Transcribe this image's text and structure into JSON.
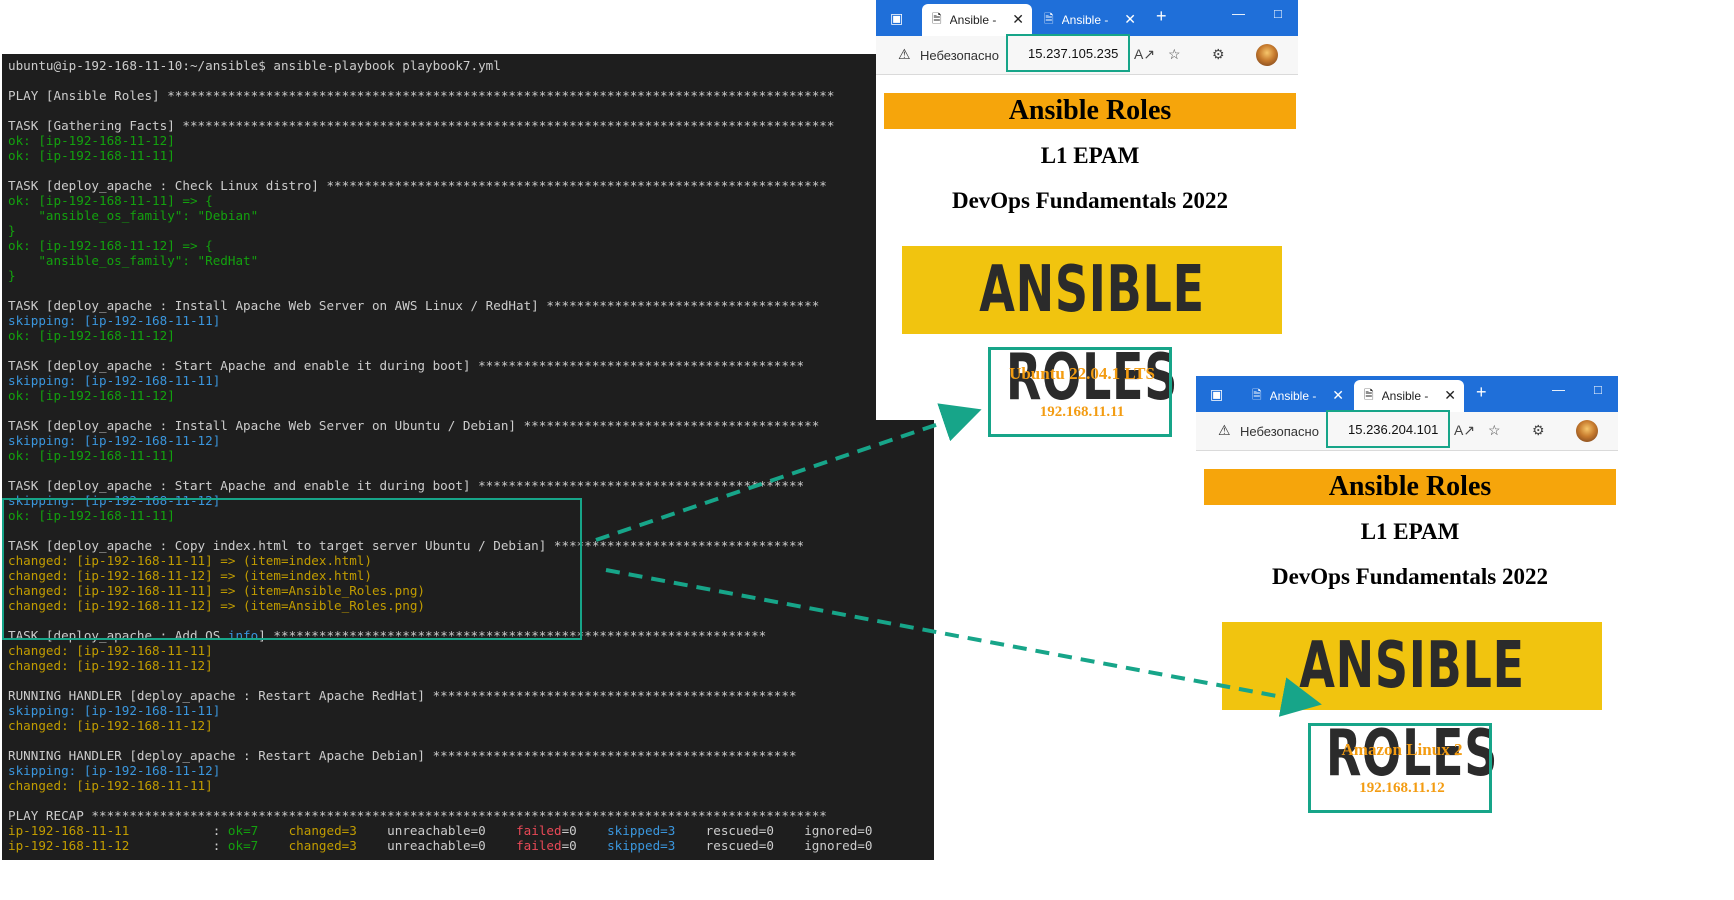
{
  "terminal": {
    "lines": [
      [
        {
          "t": "ubuntu@ip-192-168-11-10:~/ansible$ ansible-playbook playbook7.yml",
          "c": "w"
        }
      ],
      [
        {
          "t": "",
          "c": "w"
        }
      ],
      [
        {
          "t": "PLAY [Ansible Roles] ****************************************************************************************",
          "c": "w"
        }
      ],
      [
        {
          "t": "",
          "c": "w"
        }
      ],
      [
        {
          "t": "TASK [Gathering Facts] **************************************************************************************",
          "c": "w"
        }
      ],
      [
        {
          "t": "ok: [ip-192-168-11-12]",
          "c": "ok"
        }
      ],
      [
        {
          "t": "ok: [ip-192-168-11-11]",
          "c": "ok"
        }
      ],
      [
        {
          "t": "",
          "c": "w"
        }
      ],
      [
        {
          "t": "TASK [deploy_apache : Check Linux distro] ******************************************************************",
          "c": "w"
        }
      ],
      [
        {
          "t": "ok: [ip-192-168-11-11] => {",
          "c": "ok"
        }
      ],
      [
        {
          "t": "    \"ansible_os_family\": \"Debian\"",
          "c": "ok"
        }
      ],
      [
        {
          "t": "}",
          "c": "ok"
        }
      ],
      [
        {
          "t": "ok: [ip-192-168-11-12] => {",
          "c": "ok"
        }
      ],
      [
        {
          "t": "    \"ansible_os_family\": \"RedHat\"",
          "c": "ok"
        }
      ],
      [
        {
          "t": "}",
          "c": "ok"
        }
      ],
      [
        {
          "t": "",
          "c": "w"
        }
      ],
      [
        {
          "t": "TASK [deploy_apache : Install Apache Web Server on AWS Linux / RedHat] ************************************",
          "c": "w"
        }
      ],
      [
        {
          "t": "skipping: [ip-192-168-11-11]",
          "c": "c"
        }
      ],
      [
        {
          "t": "ok: [ip-192-168-11-12]",
          "c": "ok"
        }
      ],
      [
        {
          "t": "",
          "c": "w"
        }
      ],
      [
        {
          "t": "TASK [deploy_apache : Start Apache and enable it during boot] *******************************************",
          "c": "w"
        }
      ],
      [
        {
          "t": "skipping: [ip-192-168-11-11]",
          "c": "c"
        }
      ],
      [
        {
          "t": "ok: [ip-192-168-11-12]",
          "c": "ok"
        }
      ],
      [
        {
          "t": "",
          "c": "w"
        }
      ],
      [
        {
          "t": "TASK [deploy_apache : Install Apache Web Server on Ubuntu / Debian] ***************************************",
          "c": "w"
        }
      ],
      [
        {
          "t": "skipping: [ip-192-168-11-12]",
          "c": "c"
        }
      ],
      [
        {
          "t": "ok: [ip-192-168-11-11]",
          "c": "ok"
        }
      ],
      [
        {
          "t": "",
          "c": "w"
        }
      ],
      [
        {
          "t": "TASK [deploy_apache : Start Apache and enable it during boot] *******************************************",
          "c": "w"
        }
      ],
      [
        {
          "t": "skipping: [ip-192-168-11-12]",
          "c": "c"
        }
      ],
      [
        {
          "t": "ok: [ip-192-168-11-11]",
          "c": "ok"
        }
      ],
      [
        {
          "t": "",
          "c": "w"
        }
      ],
      [
        {
          "t": "TASK [deploy_apache : Copy index.html to target server Ubuntu / Debian] *********************************",
          "c": "w"
        }
      ],
      [
        {
          "t": "changed: [ip-192-168-11-11] => (item=index.html)",
          "c": "y"
        }
      ],
      [
        {
          "t": "changed: [ip-192-168-11-12] => (item=index.html)",
          "c": "y"
        }
      ],
      [
        {
          "t": "changed: [ip-192-168-11-11] => (item=Ansible_Roles.png)",
          "c": "y"
        }
      ],
      [
        {
          "t": "changed: [ip-192-168-11-12] => (item=Ansible_Roles.png)",
          "c": "y"
        }
      ],
      [
        {
          "t": "",
          "c": "w"
        }
      ],
      [
        {
          "t": "TASK [deploy_apache : Add OS ",
          "c": "w"
        },
        {
          "t": "info",
          "c": "c"
        },
        {
          "t": "] *****************************************************************",
          "c": "w"
        }
      ],
      [
        {
          "t": "changed: [ip-192-168-11-11]",
          "c": "y"
        }
      ],
      [
        {
          "t": "changed: [ip-192-168-11-12]",
          "c": "y"
        }
      ],
      [
        {
          "t": "",
          "c": "w"
        }
      ],
      [
        {
          "t": "RUNNING HANDLER [deploy_apache : Restart Apache RedHat] ************************************************",
          "c": "w"
        }
      ],
      [
        {
          "t": "skipping: [ip-192-168-11-11]",
          "c": "c"
        }
      ],
      [
        {
          "t": "changed: [ip-192-168-11-12]",
          "c": "y"
        }
      ],
      [
        {
          "t": "",
          "c": "w"
        }
      ],
      [
        {
          "t": "RUNNING HANDLER [deploy_apache : Restart Apache Debian] ************************************************",
          "c": "w"
        }
      ],
      [
        {
          "t": "skipping: [ip-192-168-11-12]",
          "c": "c"
        }
      ],
      [
        {
          "t": "changed: [ip-192-168-11-11]",
          "c": "y"
        }
      ],
      [
        {
          "t": "",
          "c": "w"
        }
      ],
      [
        {
          "t": "PLAY RECAP *************************************************************************************************",
          "c": "w"
        }
      ],
      [
        {
          "t": "ip-192-168-11-11",
          "c": "y"
        },
        {
          "t": "           : ",
          "c": "w"
        },
        {
          "t": "ok=7",
          "c": "ok"
        },
        {
          "t": "    ",
          "c": "w"
        },
        {
          "t": "changed=3",
          "c": "y"
        },
        {
          "t": "    unreachable=0    ",
          "c": "w"
        },
        {
          "t": "failed",
          "c": "r"
        },
        {
          "t": "=0    ",
          "c": "w"
        },
        {
          "t": "skipped=3",
          "c": "c"
        },
        {
          "t": "    rescued=0    ignored=0",
          "c": "w"
        }
      ],
      [
        {
          "t": "ip-192-168-11-12",
          "c": "y"
        },
        {
          "t": "           : ",
          "c": "w"
        },
        {
          "t": "ok=7",
          "c": "ok"
        },
        {
          "t": "    ",
          "c": "w"
        },
        {
          "t": "changed=3",
          "c": "y"
        },
        {
          "t": "    unreachable=0    ",
          "c": "w"
        },
        {
          "t": "failed",
          "c": "r"
        },
        {
          "t": "=0    ",
          "c": "w"
        },
        {
          "t": "skipped=3",
          "c": "c"
        },
        {
          "t": "    rescued=0    ignored=0",
          "c": "w"
        }
      ]
    ]
  },
  "browser1": {
    "tabs": [
      {
        "label": "Ansible - D"
      },
      {
        "label": "Ansible - D"
      }
    ],
    "warning": "Небезопасно",
    "url": "15.237.105.235",
    "page": {
      "header": "Ansible Roles",
      "line1": "L1 EPAM",
      "line2": "DevOps Fundamentals 2022",
      "banner": "ANSIBLE ROLES",
      "os": "Ubuntu 22.04.1 LTS",
      "ip": "192.168.11.11"
    }
  },
  "browser2": {
    "tabs": [
      {
        "label": "Ansible - D"
      },
      {
        "label": "Ansible - D"
      }
    ],
    "warning": "Небезопасно",
    "url": "15.236.204.101",
    "page": {
      "header": "Ansible Roles",
      "line1": "L1 EPAM",
      "line2": "DevOps Fundamentals 2022",
      "banner": "ANSIBLE ROLES",
      "os": "Amazon Linux 2",
      "ip": "192.168.11.12"
    }
  },
  "colors": {
    "accent_teal": "#17a589",
    "header_orange": "#f6a50b",
    "banner_yellow": "#f1c40f",
    "os_text_orange": "#f39c12",
    "edge_tabbar": "#1f6fd9"
  },
  "icons": [
    "tab-actions-icon",
    "page-icon",
    "close-icon",
    "plus-icon",
    "minimize-icon",
    "maximize-icon",
    "warning-icon",
    "read-aloud-icon",
    "favorites-icon",
    "extensions-icon",
    "profile-avatar"
  ]
}
